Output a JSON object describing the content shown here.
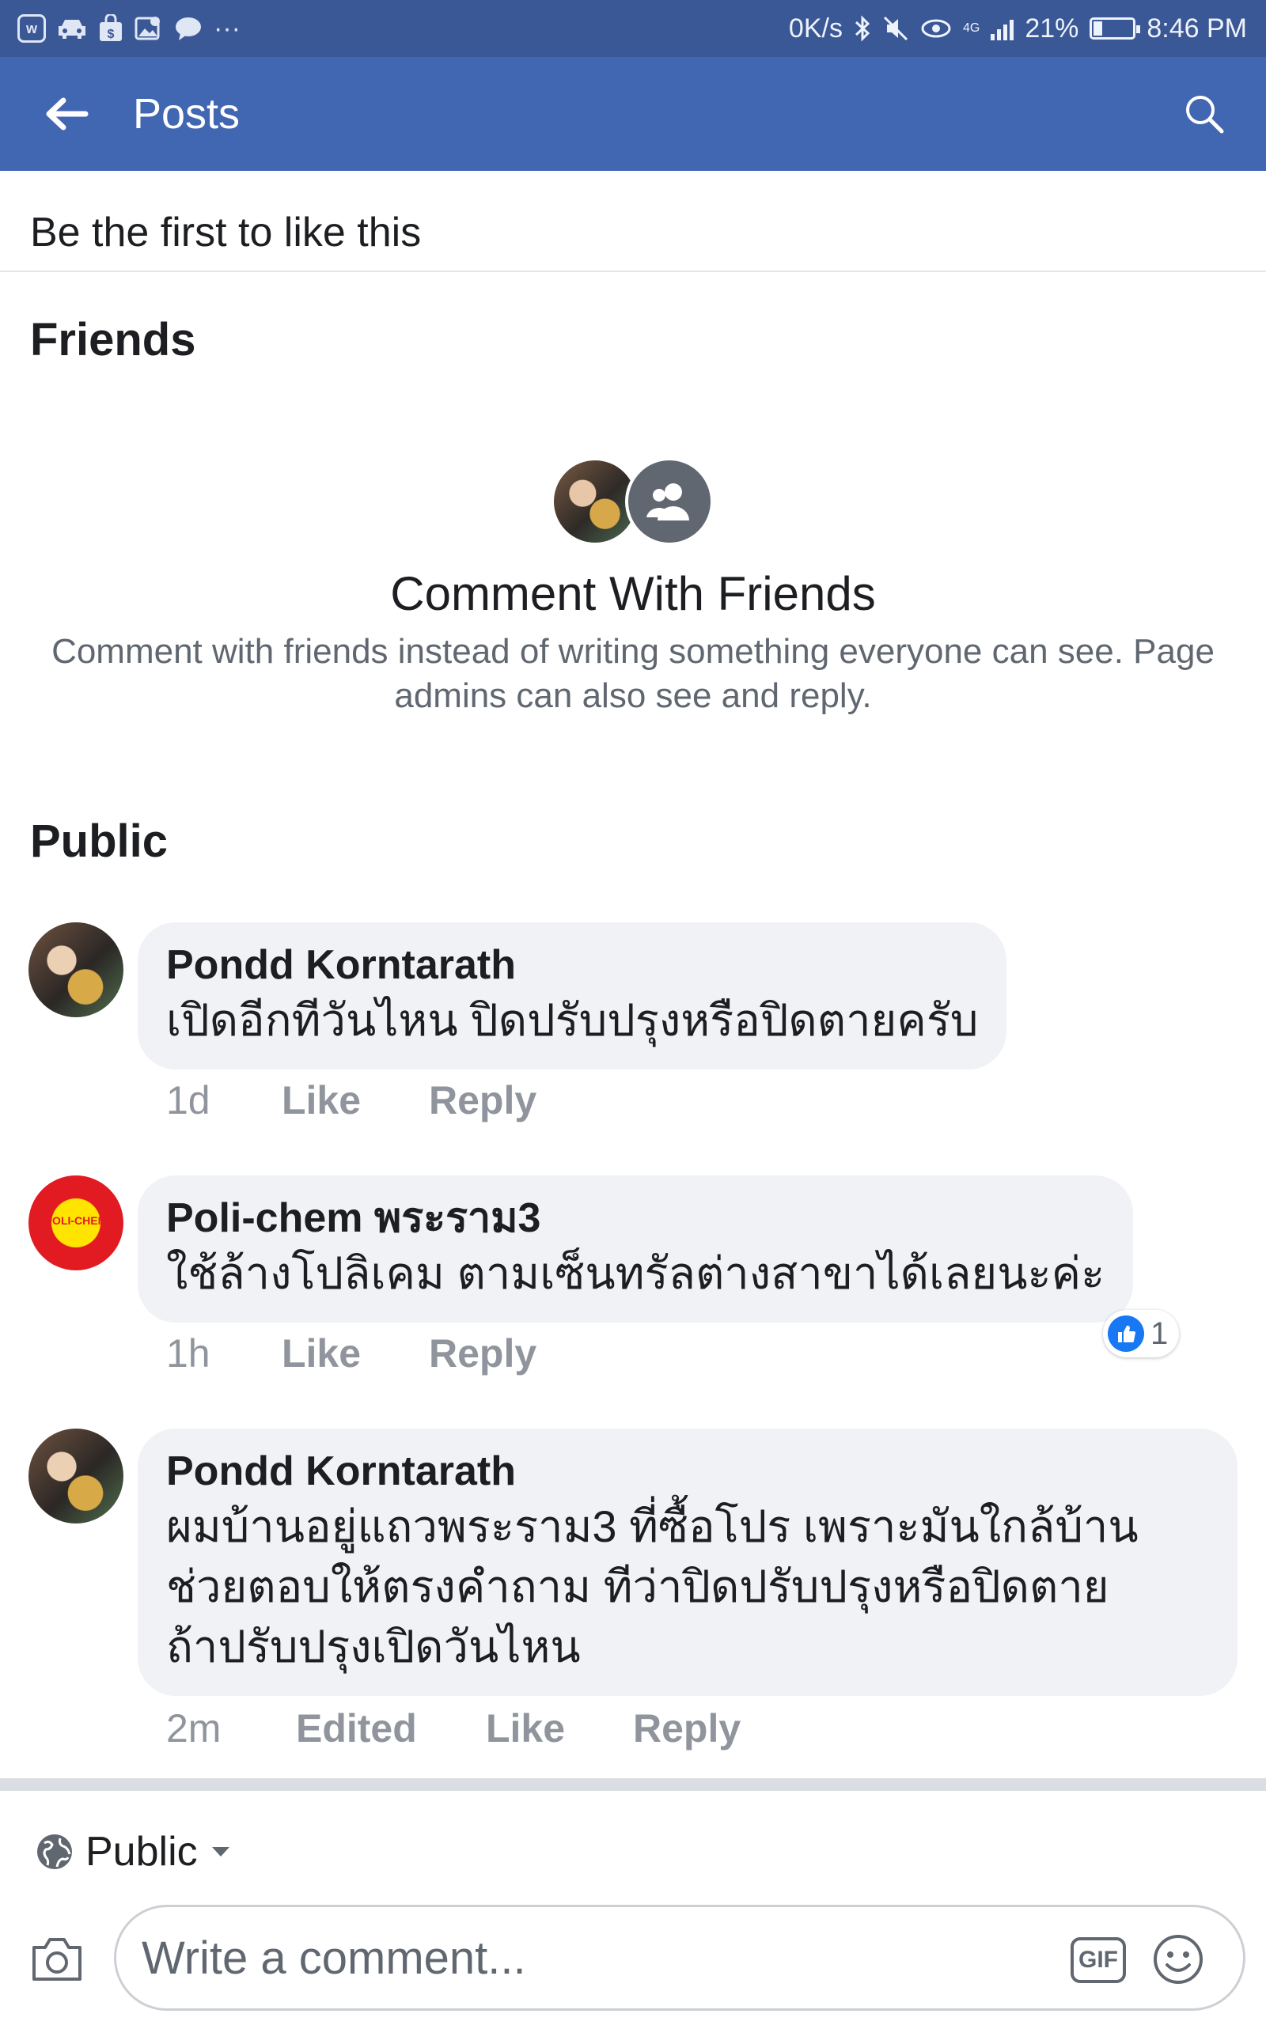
{
  "status_bar": {
    "speed": "0K/s",
    "network": "4G",
    "battery_percent": "21%",
    "battery_level": 0.21,
    "time": "8:46 PM",
    "left_icons": [
      "w-app-icon",
      "car-icon",
      "shop-bag-icon",
      "gallery-icon",
      "chat-bubble-icon",
      "more-icon"
    ],
    "more_glyph": "···"
  },
  "app_bar": {
    "title": "Posts",
    "color": "#4267b2"
  },
  "likes": {
    "text": "Be the first to like this"
  },
  "friends_section": {
    "title": "Friends",
    "cta_title": "Comment With Friends",
    "cta_description": "Comment with friends instead of writing something everyone can see. Page admins can also see and reply."
  },
  "public_section": {
    "title": "Public"
  },
  "comments": [
    {
      "author": "Pondd Korntarath",
      "text_lines": [
        "เปิดอีกทีวันไหน ปิดปรับปรุงหรือปิดตายครับ"
      ],
      "time": "1d",
      "edited": "",
      "like_label": "Like",
      "reply_label": "Reply"
    },
    {
      "author": "Poli-chem พระราม3",
      "avatar_text": "POLI-CHEM",
      "text_lines": [
        "ใช้ล้างโปลิเคม ตามเซ็นทรัลต่างสาขาได้เลยนะค่ะ"
      ],
      "time": "1h",
      "edited": "",
      "like_label": "Like",
      "reply_label": "Reply",
      "reaction_count": "1"
    },
    {
      "author": "Pondd Korntarath",
      "text_lines": [
        "ผมบ้านอยู่แถวพระราม3 ที่ซื้อโปร เพราะมันใกล้บ้าน",
        "ช่วยตอบให้ตรงคำถาม ทีว่าปิดปรับปรุงหรือปิดตาย",
        "ถ้าปรับปรุงเปิดวันไหน"
      ],
      "time": "2m",
      "edited": "Edited",
      "like_label": "Like",
      "reply_label": "Reply"
    }
  ],
  "composer": {
    "privacy_label": "Public",
    "placeholder": "Write a comment...",
    "gif_label": "GIF"
  }
}
